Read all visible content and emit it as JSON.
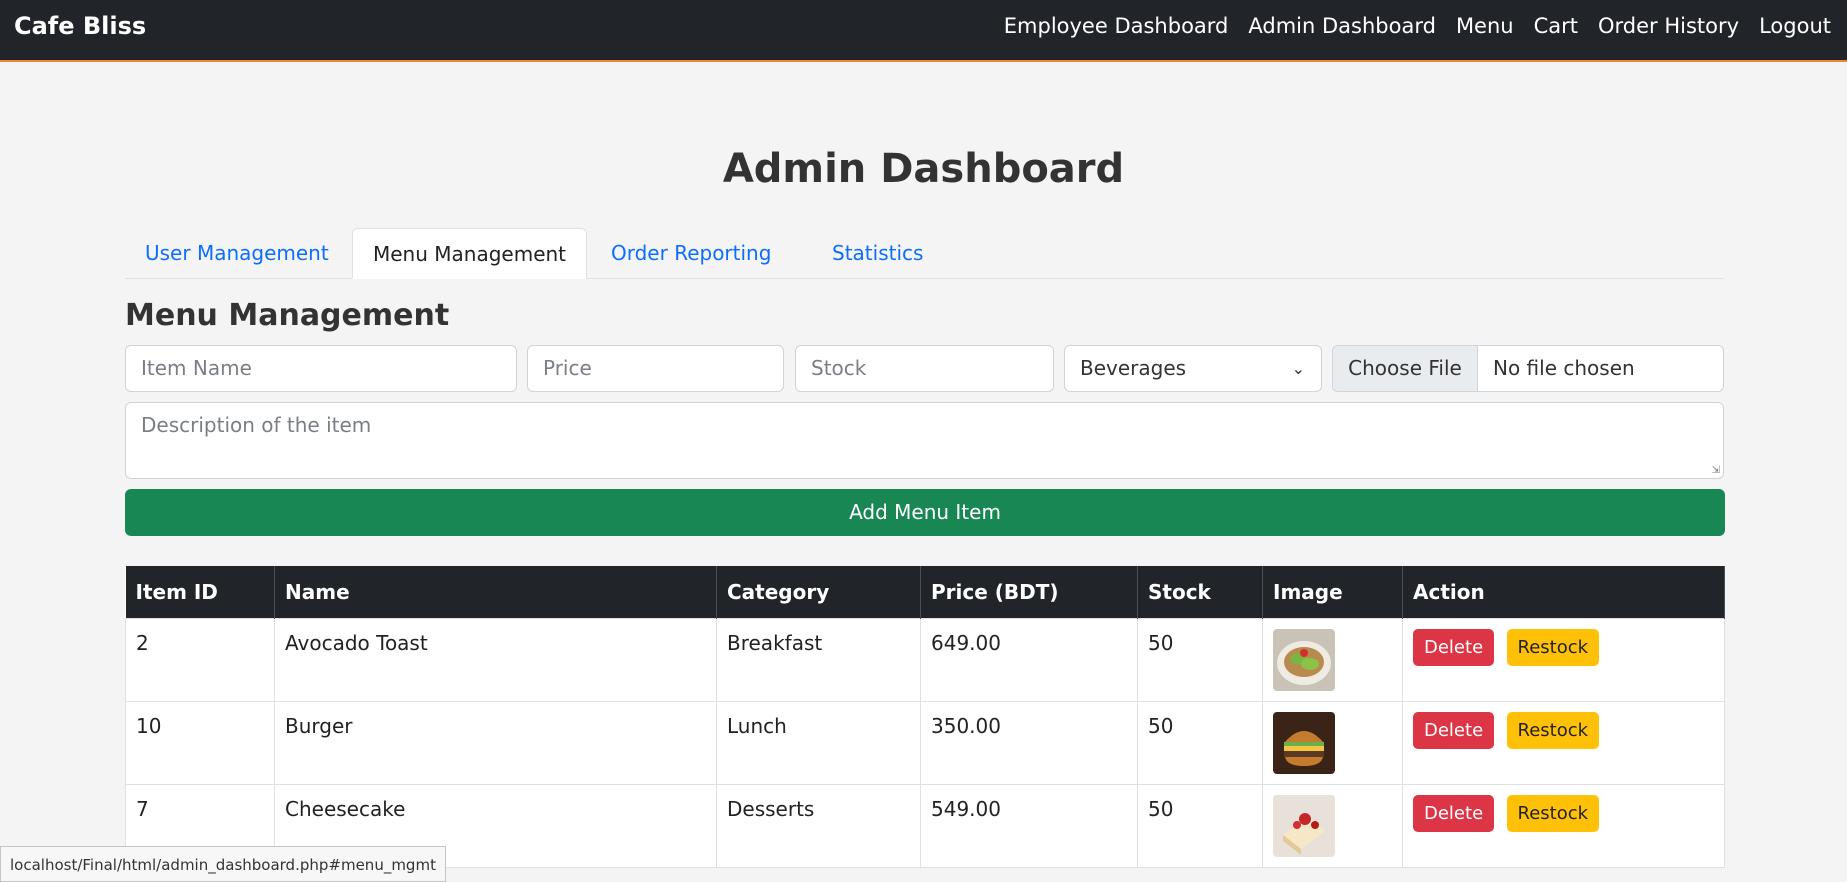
{
  "navbar": {
    "brand": "Cafe Bliss",
    "links": [
      "Employee Dashboard",
      "Admin Dashboard",
      "Menu",
      "Cart",
      "Order History",
      "Logout"
    ]
  },
  "page": {
    "title": "Admin Dashboard"
  },
  "tabs": [
    {
      "label": "User Management",
      "active": false
    },
    {
      "label": "Menu Management",
      "active": true
    },
    {
      "label": "Order Reporting",
      "active": false
    },
    {
      "label": "Statistics",
      "active": false
    }
  ],
  "form": {
    "section_title": "Menu Management",
    "item_name_placeholder": "Item Name",
    "price_placeholder": "Price",
    "stock_placeholder": "Stock",
    "category_selected": "Beverages",
    "file_button": "Choose File",
    "file_status": "No file chosen",
    "description_placeholder": "Description of the item",
    "submit_label": "Add Menu Item"
  },
  "table": {
    "headers": [
      "Item ID",
      "Name",
      "Category",
      "Price (BDT)",
      "Stock",
      "Image",
      "Action"
    ],
    "rows": [
      {
        "id": "2",
        "name": "Avocado Toast",
        "category": "Breakfast",
        "price": "649.00",
        "stock": "50",
        "image": "avocado-toast-photo"
      },
      {
        "id": "10",
        "name": "Burger",
        "category": "Lunch",
        "price": "350.00",
        "stock": "50",
        "image": "burger-photo"
      },
      {
        "id": "7",
        "name": "Cheesecake",
        "category": "Desserts",
        "price": "549.00",
        "stock": "50",
        "image": "cheesecake-photo"
      }
    ],
    "delete_label": "Delete",
    "restock_label": "Restock"
  },
  "status_bar": {
    "url": "localhost/Final/html/admin_dashboard.php#menu_mgmt"
  },
  "colors": {
    "navbar": "#212529",
    "success": "#198754",
    "danger": "#dc3545",
    "warning": "#ffc107",
    "link": "#0d6efd"
  }
}
